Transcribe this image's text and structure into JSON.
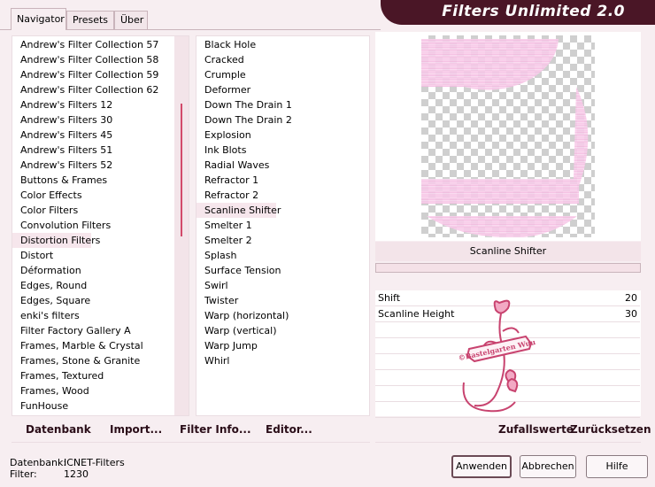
{
  "title": "Filters Unlimited 2.0",
  "tabs": [
    {
      "label": "Navigator",
      "active": true
    },
    {
      "label": "Presets",
      "active": false
    },
    {
      "label": "Über",
      "active": false
    }
  ],
  "categories": [
    "Andrew's Filter Collection 57",
    "Andrew's Filter Collection 58",
    "Andrew's Filter Collection 59",
    "Andrew's Filter Collection 62",
    "Andrew's Filters 12",
    "Andrew's Filters 30",
    "Andrew's Filters 45",
    "Andrew's Filters 51",
    "Andrew's Filters 52",
    "Buttons & Frames",
    "Color Effects",
    "Color Filters",
    "Convolution Filters",
    "Distortion Filters",
    "Distort",
    "Déformation",
    "Edges, Round",
    "Edges, Square",
    "enki's filters",
    "Filter Factory Gallery A",
    "Frames, Marble & Crystal",
    "Frames, Stone & Granite",
    "Frames, Textured",
    "Frames, Wood",
    "FunHouse"
  ],
  "selected_category": "Distortion Filters",
  "filters": [
    "Black Hole",
    "Cracked",
    "Crumple",
    "Deformer",
    "Down The Drain 1",
    "Down The Drain 2",
    "Explosion",
    "Ink Blots",
    "Radial Waves",
    "Refractor 1",
    "Refractor 2",
    "Scanline Shifter",
    "Smelter 1",
    "Smelter 2",
    "Splash",
    "Surface Tension",
    "Swirl",
    "Twister",
    "Warp (horizontal)",
    "Warp (vertical)",
    "Warp Jump",
    "Whirl"
  ],
  "selected_filter": "Scanline Shifter",
  "preview_caption": "Scanline Shifter",
  "params": [
    {
      "name": "Shift",
      "value": "20"
    },
    {
      "name": "Scanline Height",
      "value": "30"
    }
  ],
  "watermark_text": "©Bastelgarten Wuu",
  "toolbar": {
    "database": "Datenbank",
    "import": "Import...",
    "filter_info": "Filter Info...",
    "editor": "Editor...",
    "random": "Zufallswerte",
    "reset": "Zurücksetzen"
  },
  "status": {
    "db_label": "Datenbank:",
    "db_value": "ICNET-Filters",
    "filter_label": "Filter:",
    "filter_value": "1230"
  },
  "buttons": {
    "apply": "Anwenden",
    "cancel": "Abbrechen",
    "help": "Hilfe"
  },
  "colors": {
    "accent": "#4a1626",
    "selection": "#f6e6ec",
    "preview_pink": "#f4bfe2"
  }
}
